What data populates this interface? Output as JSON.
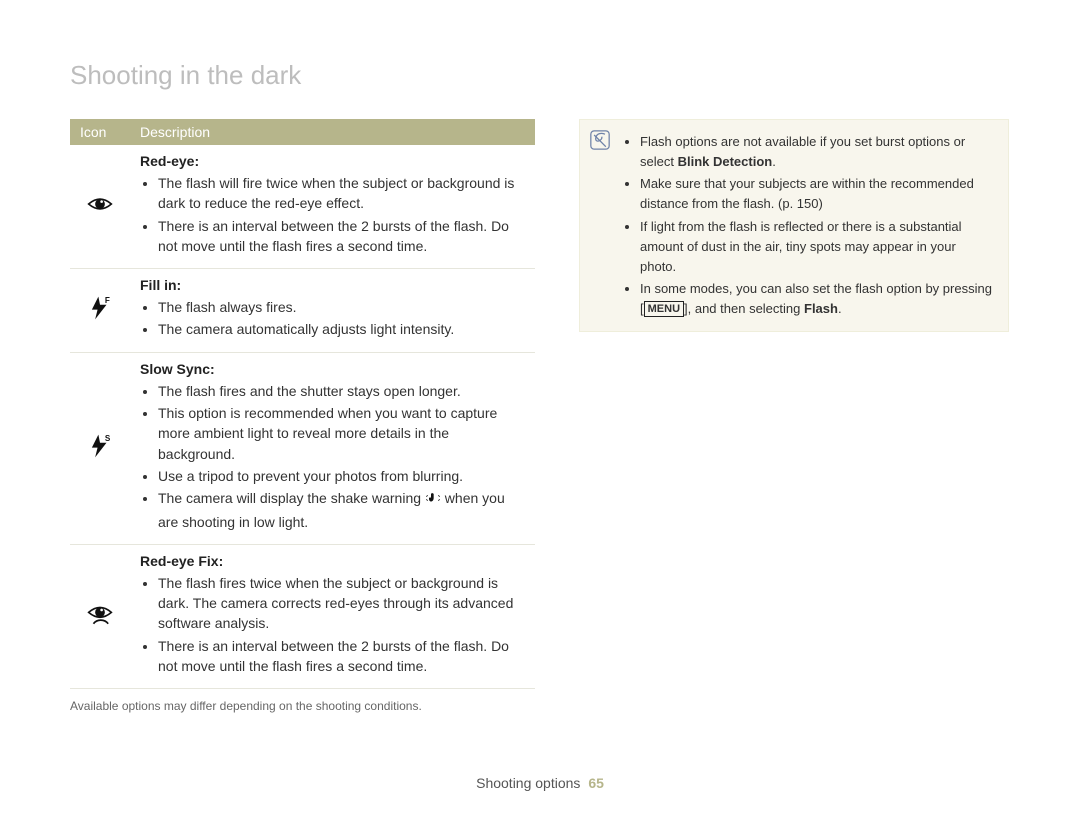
{
  "page_title": "Shooting in the dark",
  "table_headers": {
    "icon": "Icon",
    "desc": "Description"
  },
  "modes": [
    {
      "icon_name": "red-eye-icon",
      "title": "Red-eye:",
      "bullets": [
        "The flash will fire twice when the subject or background is dark to reduce the red-eye effect.",
        "There is an interval between the 2 bursts of the flash. Do not move until the flash fires a second time."
      ]
    },
    {
      "icon_name": "fill-in-icon",
      "title": "Fill in:",
      "bullets": [
        "The flash always fires.",
        "The camera automatically adjusts light intensity."
      ]
    },
    {
      "icon_name": "slow-sync-icon",
      "title": "Slow Sync:",
      "bullets": [
        "The flash fires and the shutter stays open longer.",
        "This option is recommended when you want to capture more ambient light to reveal more details in the background.",
        "Use a tripod to prevent your photos from blurring.",
        {
          "before": "The camera will display the shake warning ",
          "after": " when you are shooting in low light.",
          "has_icon": true
        }
      ]
    },
    {
      "icon_name": "red-eye-fix-icon",
      "title": "Red-eye Fix:",
      "bullets": [
        "The flash fires twice when the subject or background is dark. The camera corrects red-eyes through its advanced software analysis.",
        "There is an interval between the 2 bursts of the flash. Do not move until the flash fires a second time."
      ]
    }
  ],
  "footnote": "Available options may differ depending on the shooting conditions.",
  "notes": {
    "items": [
      {
        "before": "Flash options are not available if you set burst options or select ",
        "bold": "Blink Detection",
        "after": "."
      },
      {
        "before": "Make sure that your subjects are within the recommended distance from the flash. (p. 150)",
        "bold": "",
        "after": ""
      },
      {
        "before": "If light from the flash is reflected or there is a substantial amount of dust in the air, tiny spots may appear in your photo.",
        "bold": "",
        "after": ""
      },
      {
        "before": "In some modes, you can also set the flash option by pressing [",
        "menu": "MENU",
        "mid": "], and then selecting ",
        "bold": "Flash",
        "after": "."
      }
    ]
  },
  "footer": {
    "label": "Shooting options",
    "page": "65"
  }
}
